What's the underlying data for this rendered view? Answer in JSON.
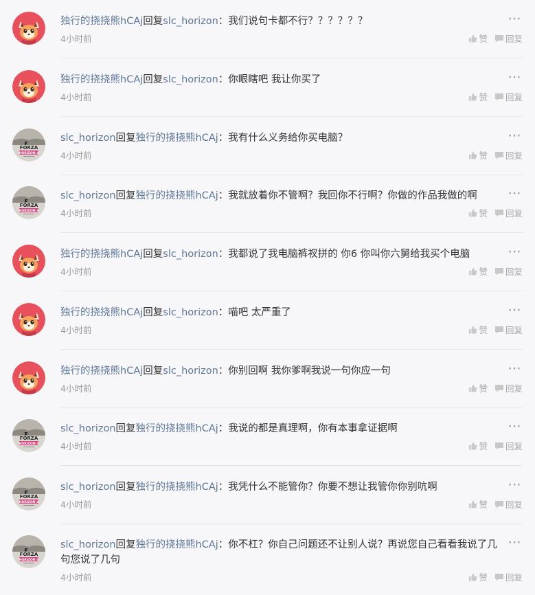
{
  "comments": [
    {
      "avatar": "raccoon",
      "from": "独行的挠挠熊hCAj",
      "reply": "回复",
      "to": "slc_horizon",
      "colon": "：",
      "text": "我们说句卡都不行？？？？？？",
      "time": "4小时前",
      "like": "赞",
      "replyBtn": "回复"
    },
    {
      "avatar": "raccoon",
      "from": "独行的挠挠熊hCAj",
      "reply": "回复",
      "to": "slc_horizon",
      "colon": "：",
      "text": "你眼瞎吧 我让你买了",
      "time": "4小时前",
      "like": "赞",
      "replyBtn": "回复"
    },
    {
      "avatar": "forza",
      "from": "slc_horizon",
      "reply": "回复",
      "to": "独行的挠挠熊hCAj",
      "colon": "：",
      "text": "我有什么义务给你买电脑？",
      "time": "4小时前",
      "like": "赞",
      "replyBtn": "回复"
    },
    {
      "avatar": "forza",
      "from": "slc_horizon",
      "reply": "回复",
      "to": "独行的挠挠熊hCAj",
      "colon": "：",
      "text": "我就放着你不管啊？我回你不行啊？你做的作品我做的啊",
      "time": "4小时前",
      "like": "赞",
      "replyBtn": "回复"
    },
    {
      "avatar": "raccoon",
      "from": "独行的挠挠熊hCAj",
      "reply": "回复",
      "to": "slc_horizon",
      "colon": "：",
      "text": "我都说了我电脑裤衩拼的 你6 你叫你六舅给我买个电脑",
      "time": "4小时前",
      "like": "赞",
      "replyBtn": "回复"
    },
    {
      "avatar": "raccoon",
      "from": "独行的挠挠熊hCAj",
      "reply": "回复",
      "to": "slc_horizon",
      "colon": "：",
      "text": "喵吧 太严重了",
      "time": "4小时前",
      "like": "赞",
      "replyBtn": "回复"
    },
    {
      "avatar": "raccoon",
      "from": "独行的挠挠熊hCAj",
      "reply": "回复",
      "to": "slc_horizon",
      "colon": "：",
      "text": "你别回啊 我你爹啊我说一句你应一句",
      "time": "4小时前",
      "like": "赞",
      "replyBtn": "回复"
    },
    {
      "avatar": "forza",
      "from": "slc_horizon",
      "reply": "回复",
      "to": "独行的挠挠熊hCAj",
      "colon": "：",
      "text": "我说的都是真理啊，你有本事拿证据啊",
      "time": "4小时前",
      "like": "赞",
      "replyBtn": "回复"
    },
    {
      "avatar": "forza",
      "from": "slc_horizon",
      "reply": "回复",
      "to": "独行的挠挠熊hCAj",
      "colon": "：",
      "text": "我凭什么不能管你？你要不想让我管你你别吭啊",
      "time": "4小时前",
      "like": "赞",
      "replyBtn": "回复"
    },
    {
      "avatar": "forza",
      "from": "slc_horizon",
      "reply": "回复",
      "to": "独行的挠挠熊hCAj",
      "colon": "：",
      "text": "你不杠？你自己问题还不让别人说？再说您自己看看我说了几句您说了几句",
      "time": "4小时前",
      "like": "赞",
      "replyBtn": "回复"
    }
  ],
  "avatars": {
    "raccoon": {
      "bg": "#e8505b",
      "face": "#f5a25d"
    },
    "forza": {
      "bg": "#d8d5cf",
      "logo": "FORZA",
      "sub": "HORIZON 4"
    }
  },
  "more_icon": "ellipsis-icon",
  "like_icon": "thumbs-up-icon",
  "reply_icon": "chat-bubble-icon"
}
